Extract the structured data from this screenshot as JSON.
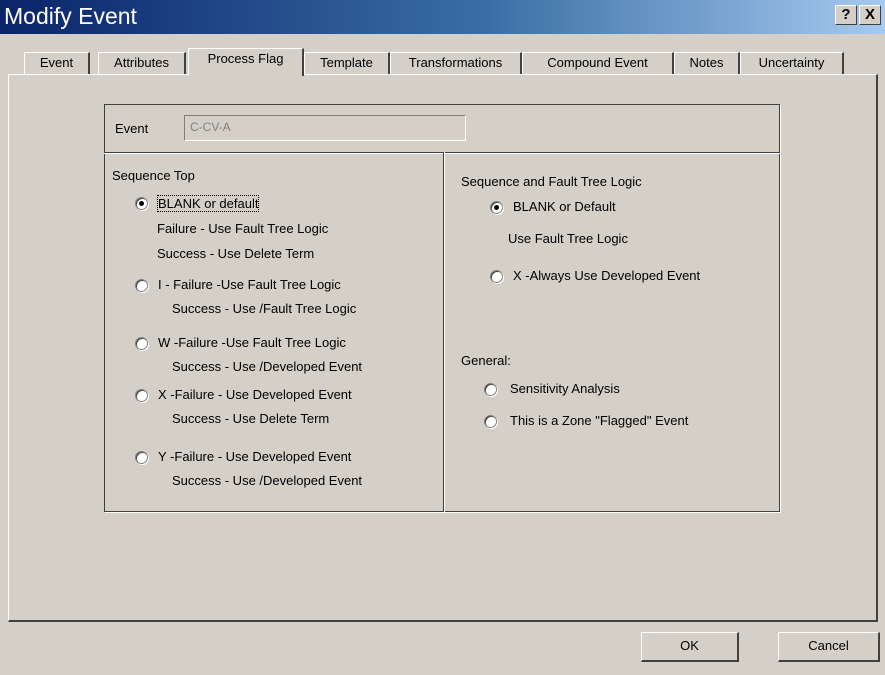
{
  "window": {
    "title": "Modify Event",
    "help_button": "?",
    "close_button": "X"
  },
  "tabs": [
    {
      "label": "Event"
    },
    {
      "label": "Attributes"
    },
    {
      "label": "Process Flag",
      "active": true
    },
    {
      "label": "Template"
    },
    {
      "label": "Transformations"
    },
    {
      "label": "Compound Event"
    },
    {
      "label": "Notes"
    },
    {
      "label": "Uncertainty"
    }
  ],
  "event": {
    "label": "Event",
    "value": "C-CV-A"
  },
  "sequence_top": {
    "heading": "Sequence Top",
    "options": [
      {
        "label": "BLANK or default",
        "line2": "Failure - Use Fault Tree Logic",
        "line3": "Success - Use Delete Term",
        "checked": true
      },
      {
        "label": "I - Failure -Use Fault Tree Logic",
        "line2": "Success - Use /Fault Tree Logic",
        "checked": false
      },
      {
        "label": "W -Failure  -Use Fault Tree Logic",
        "line2": "Success - Use /Developed Event",
        "checked": false
      },
      {
        "label": "X -Failure - Use Developed Event",
        "line2": "Success - Use Delete Term",
        "checked": false
      },
      {
        "label": "Y -Failure - Use Developed Event",
        "line2": "Success - Use /Developed Event",
        "checked": false
      }
    ]
  },
  "fault_tree_logic": {
    "heading": "Sequence and Fault Tree Logic",
    "options": [
      {
        "label": "BLANK or Default",
        "line2": "Use Fault Tree Logic",
        "checked": true
      },
      {
        "label": "X -Always Use Developed Event",
        "checked": false
      }
    ]
  },
  "general": {
    "heading": "General:",
    "options": [
      {
        "label": "Sensitivity Analysis",
        "checked": false
      },
      {
        "label": "This is a Zone \"Flagged\" Event",
        "checked": false
      }
    ]
  },
  "buttons": {
    "ok": "OK",
    "cancel": "Cancel"
  }
}
